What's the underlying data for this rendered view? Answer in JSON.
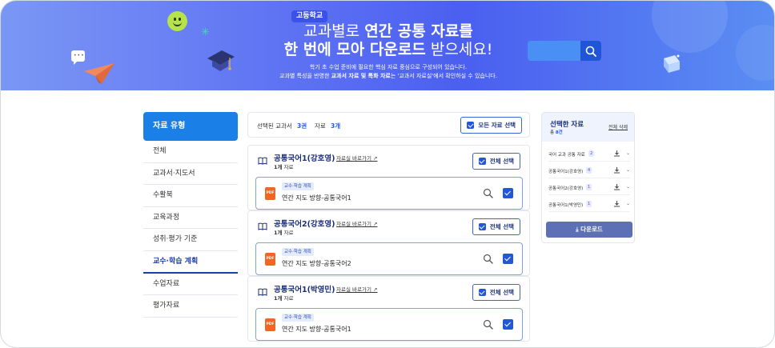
{
  "banner": {
    "badge": "고등학교",
    "title_line1_pre": "교과별로 ",
    "title_line1_bold": "연간 공통 자료를",
    "title_line2_bold": "한 번에 모아 다운로드",
    "title_line2_post": " 받으세요!",
    "subtitle_line1": "학기 초 수업 준비에 필요한 핵심 자료 중심으로 구성되어 있습니다.",
    "subtitle_line2_pre": "교과별 특성을 반영한 ",
    "subtitle_line2_bold": "교과서 자료 및 특화 자료",
    "subtitle_line2_post": "는 '교과서 자료실'에서 확인하실 수 있습니다.",
    "search_placeholder": ""
  },
  "sidebar": {
    "title": "자료 유형",
    "items": [
      {
        "label": "전체"
      },
      {
        "label": "교과서·지도서"
      },
      {
        "label": "수활북"
      },
      {
        "label": "교육과정"
      },
      {
        "label": "성취·평가 기준"
      },
      {
        "label": "교수·학습 계획"
      },
      {
        "label": "수업자료"
      },
      {
        "label": "평가자료"
      }
    ],
    "active_index": 5
  },
  "main": {
    "selected_textbook_label": "선택된 교과서",
    "selected_textbook_count": "3권",
    "material_label": "자료",
    "material_count": "3개",
    "select_all_label": "모든 자료 선택",
    "groups": [
      {
        "title": "공통국어1(강호영)",
        "link": "자료실 바로가기",
        "count_bold": "1개",
        "count_suffix": " 자료",
        "select_label": "전체 선택",
        "file": {
          "tag": "교수·학습 계획",
          "name": "연간 지도 방향-공통국어1",
          "type": "PDF"
        }
      },
      {
        "title": "공통국어2(강호영)",
        "link": "자료실 바로가기",
        "count_bold": "1개",
        "count_suffix": " 자료",
        "select_label": "전체 선택",
        "file": {
          "tag": "교수·학습 계획",
          "name": "연간 지도 방향-공통국어2",
          "type": "PDF"
        }
      },
      {
        "title": "공통국어1(박영민)",
        "link": "자료실 바로가기",
        "count_bold": "1개",
        "count_suffix": " 자료",
        "select_label": "전체 선택",
        "file": {
          "tag": "교수·학습 계획",
          "name": "연간 지도 방향-공통국어1",
          "type": "PDF"
        }
      }
    ]
  },
  "selected_panel": {
    "title": "선택한 자료",
    "total_prefix": "총 ",
    "total_count": "8건",
    "clear_label": "전체 삭제",
    "items": [
      {
        "name": "국어 교과 공통 자료",
        "count": "2"
      },
      {
        "name": "공통국어1(강호영)",
        "count": "4"
      },
      {
        "name": "공통국어2(강호영)",
        "count": "1"
      },
      {
        "name": "공통국어1(박영민)",
        "count": "1"
      }
    ],
    "download_label": "다운로드"
  },
  "colors": {
    "banner_start": "#7b97f5",
    "banner_end": "#5a8ef3",
    "primary": "#1a7fe6",
    "accent_navy": "#1b2f7a",
    "checkbox": "#2456d8",
    "pdf": "#f26522",
    "download_button": "#5d70b5"
  },
  "icons": [
    "smiley-icon",
    "sparkle-icon",
    "graduation-cap-icon",
    "chat-bubble-icon",
    "paper-plane-icon",
    "cube-icon",
    "search-icon",
    "book-icon",
    "external-link-icon",
    "pdf-icon",
    "checkbox-icon",
    "download-icon",
    "chevron-down-icon"
  ]
}
